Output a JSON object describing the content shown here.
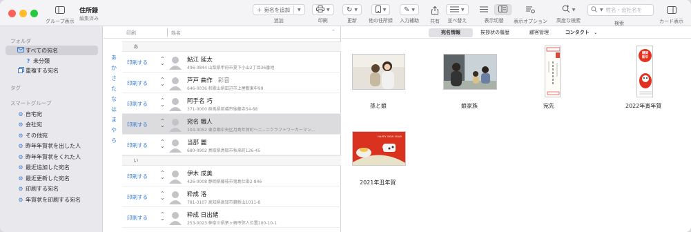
{
  "toolbar": {
    "group_view": "グループ表示",
    "title": "住所録",
    "subtitle": "編集済み",
    "add_button": "宛名を追加",
    "add_label": "追加",
    "print_label": "印刷",
    "update_label": "更新",
    "other_address_label": "他の住所録",
    "input_assist_label": "入力補助",
    "share_label": "共有",
    "sort_label": "並べ替え",
    "view_toggle_label": "表示切替",
    "view_options_label": "表示オプション",
    "advanced_label": "高度な検索",
    "search_label": "検索",
    "search_placeholder": "姓名・会社名を",
    "card_label": "カード表示"
  },
  "sidebar": {
    "folder_section": "フォルダ",
    "folder_items": [
      {
        "label": "すべての宛名",
        "selected": true
      },
      {
        "label": "未分類",
        "selected": false
      },
      {
        "label": "重複する宛名",
        "selected": false
      }
    ],
    "tag_section": "タグ",
    "smart_section": "スマートグループ",
    "smart_items": [
      "自宅宛",
      "会社宛",
      "その他宛",
      "昨年年賀状を出した人",
      "昨年年賀状をくれた人",
      "最近追加した宛名",
      "最近更新した宛名",
      "印刷する宛名",
      "年賀状を印刷する宛名"
    ]
  },
  "list": {
    "col_print": "印刷",
    "col_name": "姓名",
    "index": [
      "あ",
      "か",
      "さ",
      "た",
      "な",
      "は",
      "ま",
      "や",
      "ら"
    ],
    "groups": [
      {
        "header": "あ",
        "rows": [
          {
            "print": "印刷する",
            "name": "鮎江 延太",
            "yomi": "",
            "address": "496-0844 山梨県甲府市夏下小山2丁目36番地",
            "selected": false
          },
          {
            "print": "印刷する",
            "name": "芦戸 曲作",
            "yomi": "彩音",
            "address": "646-0036 和歌山県田辺市上屋敷東中99",
            "selected": false
          },
          {
            "print": "印刷する",
            "name": "阿手名 巧",
            "yomi": "",
            "address": "371-0000 群馬県前橋市後藤寺54-68",
            "selected": false
          },
          {
            "print": "印刷する",
            "name": "宛名 職人",
            "yomi": "",
            "address": "104-0052 東京都中央区月島年賀町〜ニ−ニクラフトワーカーマン…",
            "selected": true
          },
          {
            "print": "印刷する",
            "name": "当部 麗",
            "yomi": "",
            "address": "680-0902 鳥取県鳥取市秋来町126-45",
            "selected": false
          }
        ]
      },
      {
        "header": "い",
        "rows": [
          {
            "print": "印刷する",
            "name": "伊木 成美",
            "yomi": "",
            "address": "426-0008 静岡県藤枝市鬼島仕掛2-846",
            "selected": false
          },
          {
            "print": "印刷する",
            "name": "粋成 洛",
            "yomi": "",
            "address": "781-3107 高知県高知市鏡新山1011-8",
            "selected": false
          },
          {
            "print": "印刷する",
            "name": "粋成 日出緒",
            "yomi": "",
            "address": "253-0023 神奈川県茅ヶ崎市弥人位置100-10-1",
            "selected": false
          }
        ]
      }
    ]
  },
  "detail": {
    "tabs": [
      "宛名情報",
      "挨拶状の履歴",
      "顧客管理",
      "コンタクト"
    ],
    "thumbnails": [
      {
        "caption": "孫と娘"
      },
      {
        "caption": "娘家族"
      },
      {
        "caption": "宛先"
      },
      {
        "caption": "2022年寅年賀"
      },
      {
        "caption": "2021年丑年賀"
      }
    ],
    "card_text": {
      "greeting_a": "謹賀",
      "greeting_b": "新年",
      "happy": "HAPPY NEW YEAR"
    }
  },
  "colors": {
    "accent": "#3c7ed6",
    "selected_row": "#dcdcdf",
    "sidebar_bg": "#e9e8ed",
    "card_red": "#e3301f"
  }
}
